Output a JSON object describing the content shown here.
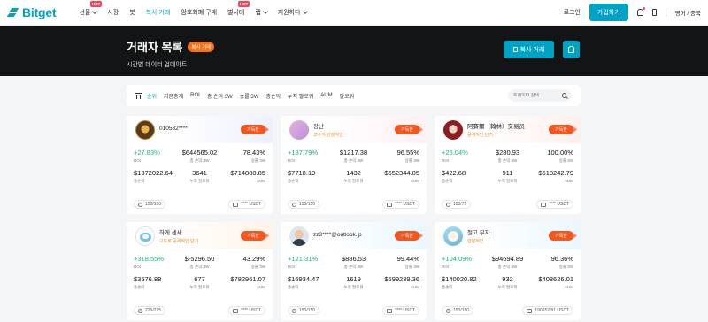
{
  "nav": {
    "logo": "Bitget",
    "menu": [
      {
        "label": "선물",
        "hot": "HOT",
        "chevron": true
      },
      {
        "label": "시장",
        "hot": "",
        "chevron": false
      },
      {
        "label": "봇",
        "hot": "",
        "chevron": false
      },
      {
        "label": "복사 거래",
        "hot": "",
        "chevron": false,
        "active": true
      },
      {
        "label": "암호화폐 구매",
        "hot": "",
        "chevron": false
      },
      {
        "label": "벌사대",
        "hot": "HOT",
        "chevron": false
      },
      {
        "label": "랩",
        "hot": "",
        "chevron": true
      },
      {
        "label": "지원하다",
        "hot": "",
        "chevron": true
      }
    ],
    "login": "로그인",
    "signup": "가입하기",
    "lang": "영어 / 중국"
  },
  "hero": {
    "title": "거래자 목록",
    "badge": "복사 거래",
    "subtitle": "시간별 데이터 업데이트",
    "copy_button": "복사 거래"
  },
  "filter": {
    "sorts": [
      "순위",
      "자본총계",
      "ROI",
      "총 손익 3W",
      "승률 3W",
      "총손익",
      "누적 팔로워",
      "AUM",
      "팔로워"
    ],
    "search_placeholder": "트레이더 검색"
  },
  "labels": {
    "roi": "ROI",
    "pnl3w": "총 손익 3W",
    "win3w": "승률 3W",
    "pnl": "총손익",
    "followers": "누적 팔로워",
    "aum": "AUM",
    "follow": "가득한"
  },
  "traders": [
    {
      "name": "010582****",
      "sub": "",
      "roi": "+27.83%",
      "pnl3w": "$644565.02",
      "win3w": "78.43%",
      "pnl": "$1372022.64",
      "followers": "3641",
      "aum": "$714880.85",
      "slots": "150/150",
      "usdt": "**** USDT"
    },
    {
      "name": "장난",
      "sub": "고수익 안정적인",
      "roi": "+187.79%",
      "pnl3w": "$1217.38",
      "win3w": "96.55%",
      "pnl": "$7718.19",
      "followers": "1432",
      "aum": "$652344.05",
      "slots": "150/150",
      "usdt": "**** USDT"
    },
    {
      "name": "阿賽爾（翰林）交易员",
      "sub": "공격적인 단기",
      "roi": "+25.04%",
      "pnl3w": "$280.93",
      "win3w": "100.00%",
      "pnl": "$422.68",
      "followers": "911",
      "aum": "$618242.79",
      "slots": "150/75",
      "usdt": "**** USDT"
    },
    {
      "name": "하게 센세",
      "sub": "고도로 공격적인 단기",
      "roi": "+318.55%",
      "pnl3w": "$-5296.50",
      "win3w": "43.29%",
      "pnl": "$3576.88",
      "followers": "677",
      "aum": "$782961.07",
      "slots": "225/225",
      "usdt": "**** USDT"
    },
    {
      "name": "zz3****@outlook.jp",
      "sub": "",
      "roi": "+121.31%",
      "pnl3w": "$886.53",
      "win3w": "99.44%",
      "pnl": "$16934.47",
      "followers": "1619",
      "aum": "$699239.36",
      "slots": "150/150",
      "usdt": "**** USDT"
    },
    {
      "name": "절고 부자",
      "sub": "안정적인",
      "roi": "+104.09%",
      "pnl3w": "$94694.89",
      "win3w": "96.36%",
      "pnl": "$140020.82",
      "followers": "932",
      "aum": "$408626.01",
      "slots": "150/150",
      "usdt": "190152.81 USDT"
    }
  ]
}
